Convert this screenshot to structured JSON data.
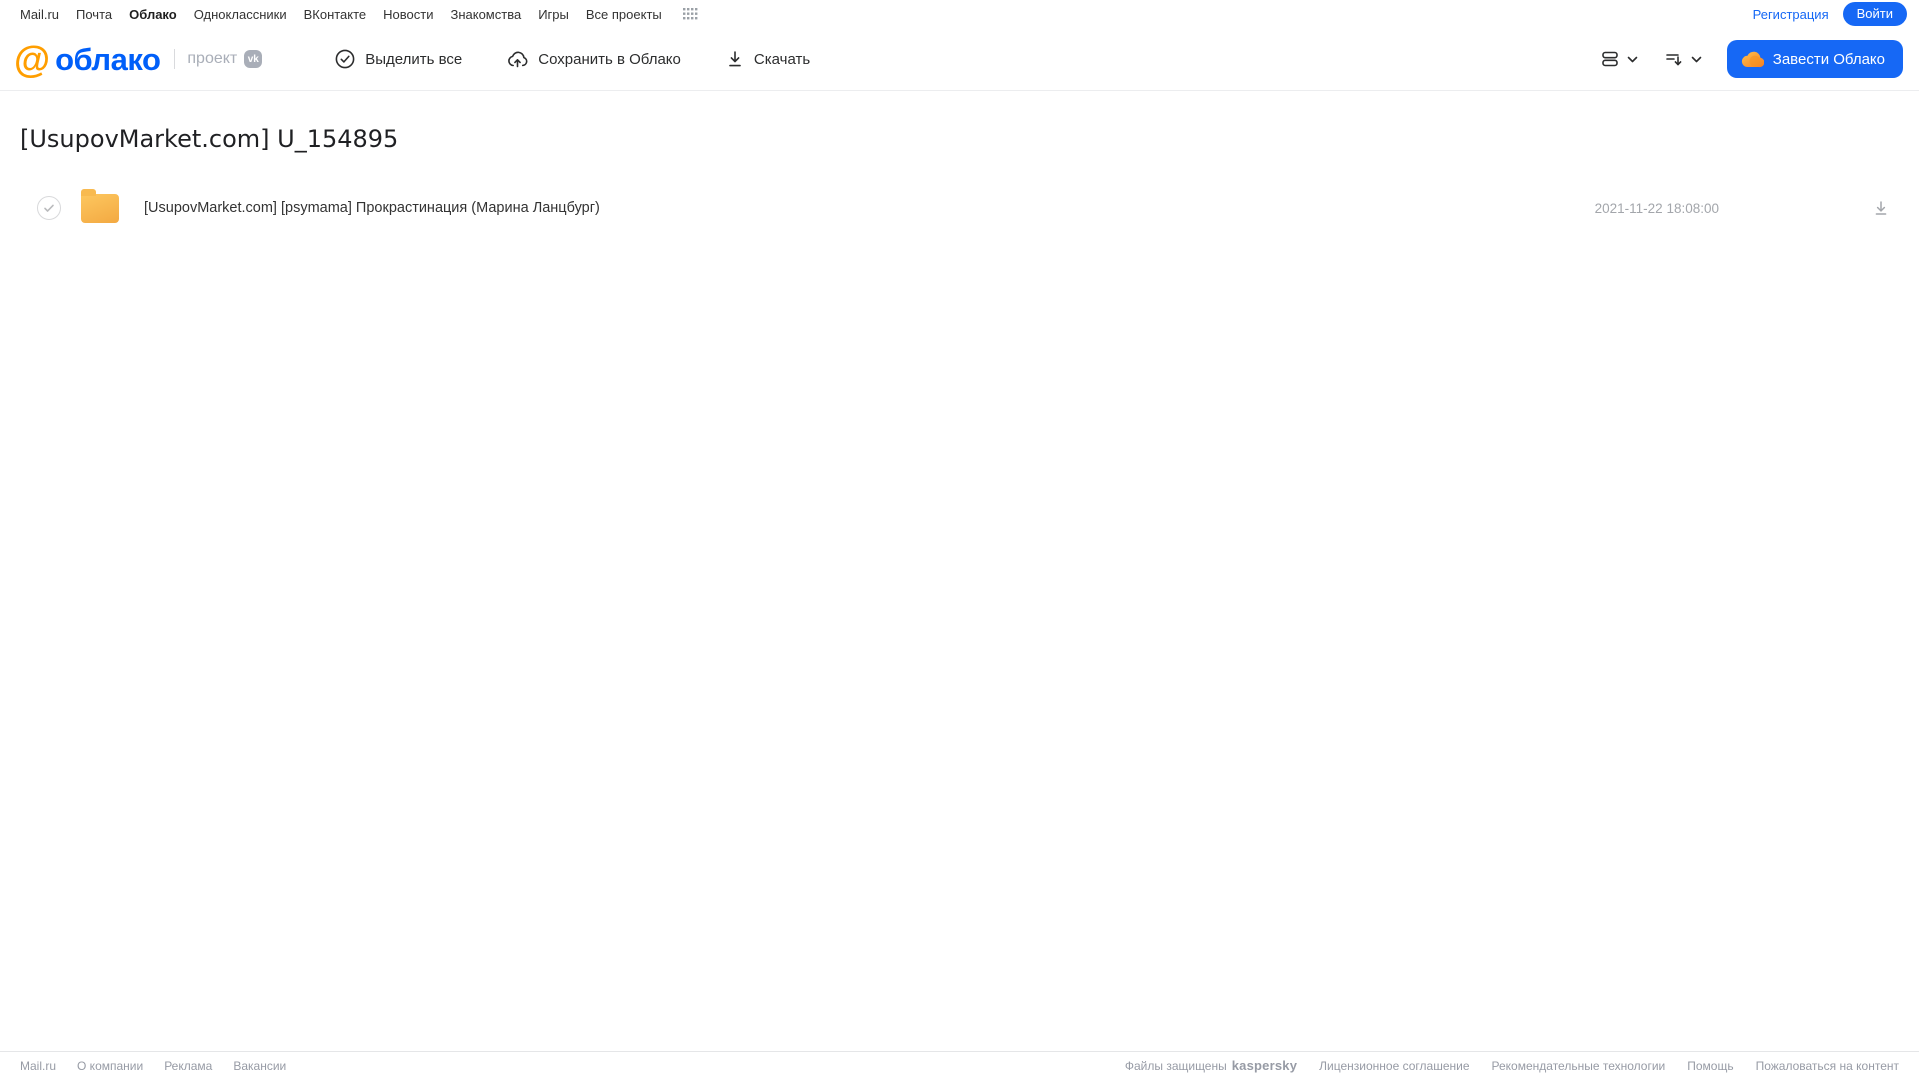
{
  "topnav": {
    "items": [
      "Mail.ru",
      "Почта",
      "Облако",
      "Одноклассники",
      "ВКонтакте",
      "Новости",
      "Знакомства",
      "Игры",
      "Все проекты"
    ],
    "active_item": "Облако",
    "registration": "Регистрация",
    "login": "Войти"
  },
  "header": {
    "logo_at": "@",
    "logo_text": "облако",
    "project_label": "проект",
    "vk_badge": "vk",
    "toolbar": {
      "select_all": "Выделить все",
      "save_to_cloud": "Сохранить в Облако",
      "download": "Скачать"
    },
    "get_cloud_button": "Завести Облако"
  },
  "main": {
    "title": "[UsupovMarket.com] U_154895",
    "files": [
      {
        "type": "folder",
        "name": "[UsupovMarket.com] [psymama] Прокрастинация (Марина Ланцбург)",
        "date": "2021-11-22 18:08:00"
      }
    ]
  },
  "footer": {
    "left_links": [
      "Mail.ru",
      "О компании",
      "Реклама",
      "Вакансии"
    ],
    "protected_text": "Файлы защищены",
    "kaspersky": "kaspersky",
    "right_links": [
      "Лицензионное соглашение",
      "Рекомендательные технологии",
      "Помощь",
      "Пожаловаться на контент"
    ]
  },
  "colors": {
    "accent_blue": "#1668f5",
    "logo_blue": "#005ff9",
    "logo_orange": "#ff9e00",
    "folder_yellow": "#f6b14e",
    "kaspersky_green": "#00a88e"
  }
}
